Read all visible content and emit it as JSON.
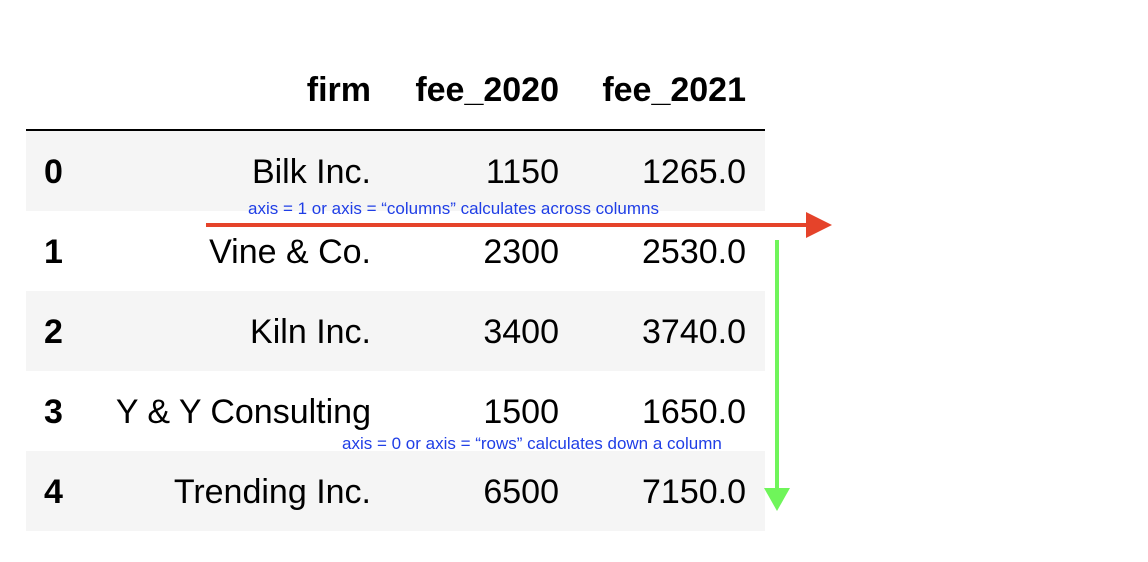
{
  "table": {
    "columns": [
      "firm",
      "fee_2020",
      "fee_2021"
    ],
    "rows": [
      {
        "index": "0",
        "firm": "Bilk Inc.",
        "fee_2020": "1150",
        "fee_2021": "1265.0"
      },
      {
        "index": "1",
        "firm": "Vine & Co.",
        "fee_2020": "2300",
        "fee_2021": "2530.0"
      },
      {
        "index": "2",
        "firm": "Kiln Inc.",
        "fee_2020": "3400",
        "fee_2021": "3740.0"
      },
      {
        "index": "3",
        "firm": "Y & Y Consulting",
        "fee_2020": "1500",
        "fee_2021": "1650.0"
      },
      {
        "index": "4",
        "firm": "Trending Inc.",
        "fee_2020": "6500",
        "fee_2021": "7150.0"
      }
    ]
  },
  "annotations": {
    "axis_columns": "axis = 1 or axis = “columns” calculates across columns",
    "axis_rows": "axis = 0 or axis = “rows” calculates down a column"
  },
  "colors": {
    "columns_arrow": "#e5432a",
    "rows_arrow": "#6ff55a",
    "annotation_text": "#1f3ee6",
    "row_shade": "#f5f5f5"
  }
}
